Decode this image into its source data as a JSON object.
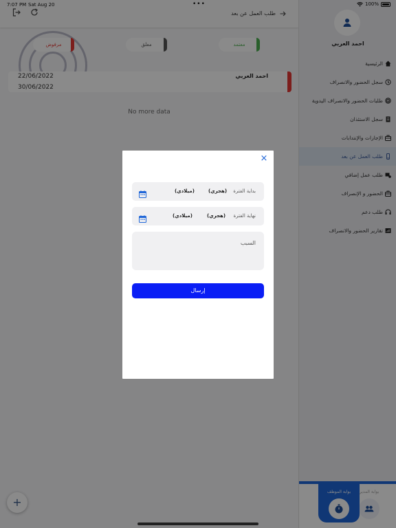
{
  "status_bar": {
    "time": "7:07 PM",
    "date": "Sat Aug 20",
    "dots": "•••",
    "battery": "100%"
  },
  "header": {
    "title": "طلب العمل عن بعد"
  },
  "filters": [
    {
      "label": "مرفوض",
      "color": "#e53935"
    },
    {
      "label": "معلق",
      "color": "#555555"
    },
    {
      "label": "معتمد",
      "color": "#4caf50"
    }
  ],
  "record": {
    "name": "احمد العربي",
    "start_date": "22/06/2022",
    "end_date": "30/06/2022"
  },
  "list": {
    "empty_text": "No more data"
  },
  "fab": {
    "label": "+"
  },
  "user": {
    "name": "احمد العربي"
  },
  "sidebar": {
    "items": [
      {
        "label": "الرئيسية",
        "icon": "home-icon"
      },
      {
        "label": "سجل الحضور والانصراف",
        "icon": "history-icon"
      },
      {
        "label": "طلبات الحضور والانصراف اليدوية",
        "icon": "fingerprint-icon"
      },
      {
        "label": "سجل الاستئذان",
        "icon": "document-icon"
      },
      {
        "label": "الإجازات والإنتدابات",
        "icon": "briefcase-icon"
      },
      {
        "label": "طلب العمل عن بعد",
        "icon": "remote-icon",
        "active": true
      },
      {
        "label": "طلب عمل إضافي",
        "icon": "overtime-icon"
      },
      {
        "label": "الحضور و الإنصراف",
        "icon": "briefcase-icon"
      },
      {
        "label": "طلب دعم",
        "icon": "support-icon"
      },
      {
        "label": "تقارير الحضور والانصراف",
        "icon": "report-icon"
      }
    ]
  },
  "portals": {
    "employee": "بوابة الموظف",
    "manager": "بوابة المدير"
  },
  "dialog": {
    "close": "×",
    "start": {
      "label": "بداية الفترة",
      "hijri": "(هجري)",
      "gregorian": "(ميلادي)"
    },
    "end": {
      "label": "نهاية الفترة",
      "hijri": "(هجري)",
      "gregorian": "(ميلادي)"
    },
    "reason_placeholder": "السبب",
    "submit": "إرسال"
  },
  "colors": {
    "accent": "#1f66d8",
    "submit": "#0a1ef5",
    "rejected": "#e53935"
  }
}
